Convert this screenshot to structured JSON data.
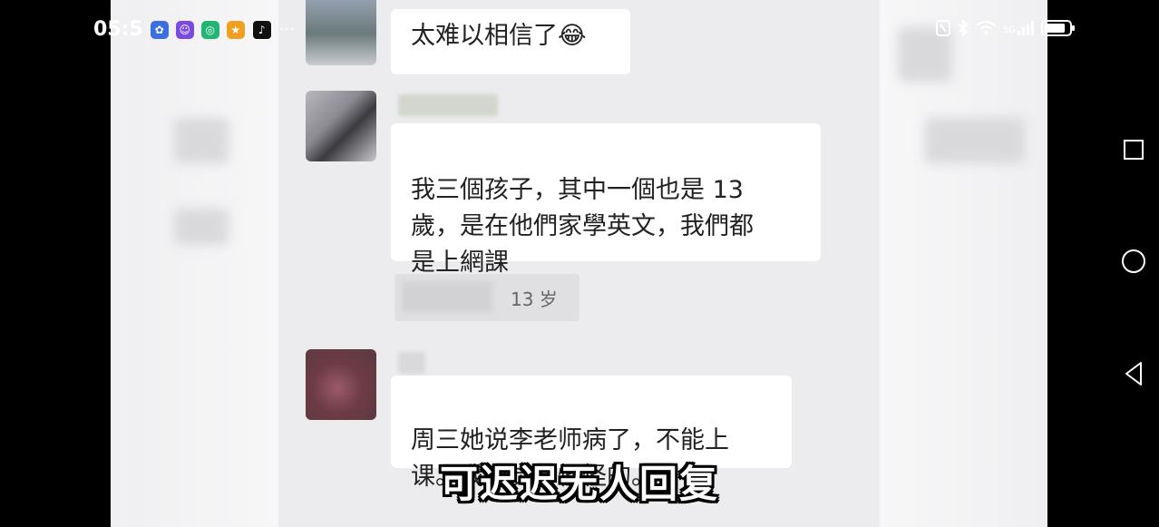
{
  "status_bar": {
    "time": "05:5",
    "app_icons": [
      "baidu-icon",
      "assistant-icon",
      "chat-app-icon",
      "game-icon",
      "tiktok-icon"
    ],
    "more": "···",
    "network": "5G",
    "battery_level": 0.85
  },
  "chat": {
    "messages": [
      {
        "text": "太难以相信了😂"
      },
      {
        "text": "我三個孩子，其中一個也是 13\n歲，是在他們家學英文，我們都\n是上網課",
        "quote": "13 岁"
      },
      {
        "text": "周三她说李老师病了，不能上\n课。我也觉得怪怪的。"
      }
    ]
  },
  "subtitle": "可迟迟无人回复",
  "colors": {
    "background": "#000000",
    "chat_bg": "#ececee",
    "bubble": "#ffffff",
    "subtitle_fill": "#ffffff"
  },
  "nav": {
    "icons": [
      "recent-apps-icon",
      "home-icon",
      "back-icon"
    ]
  }
}
